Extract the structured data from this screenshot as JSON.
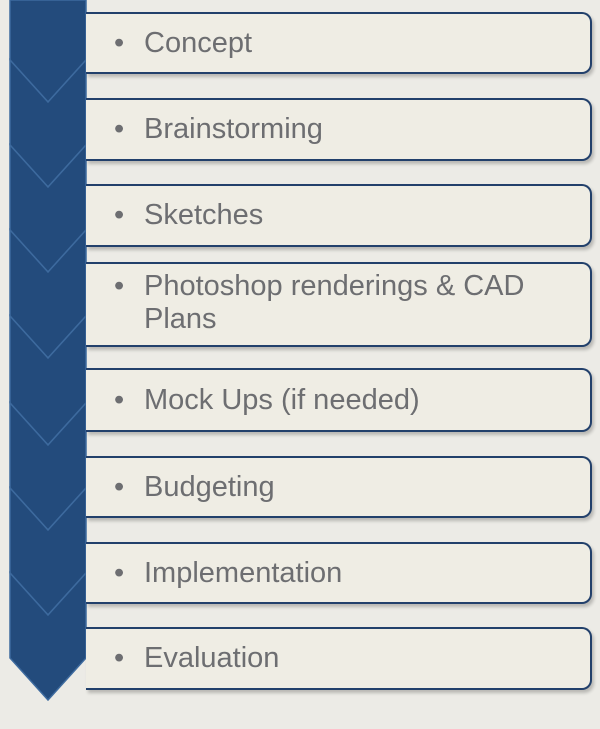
{
  "diagram": {
    "steps": [
      {
        "label": "Concept"
      },
      {
        "label": "Brainstorming"
      },
      {
        "label": "Sketches"
      },
      {
        "label": "Photoshop renderings & CAD Plans"
      },
      {
        "label": "Mock Ups (if needed)"
      },
      {
        "label": "Budgeting"
      },
      {
        "label": "Implementation"
      },
      {
        "label": "Evaluation"
      }
    ],
    "bullet": "•",
    "colors": {
      "chevron_fill": "#234b7c",
      "chevron_edge": "#3d6a9e",
      "box_background": "#efede4",
      "box_border": "#22406b",
      "text": "#6d6e71",
      "page_background": "#ecebe6"
    }
  }
}
